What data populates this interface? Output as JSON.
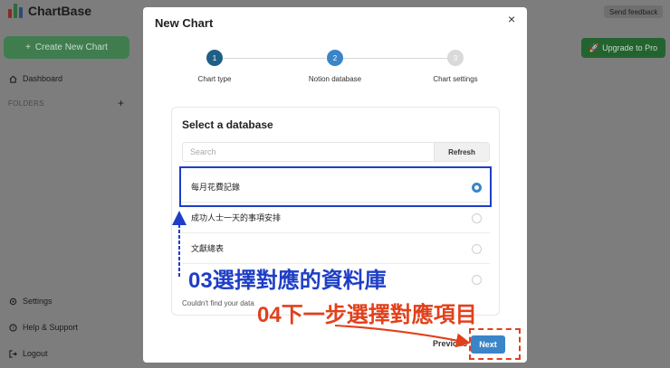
{
  "app": {
    "logo_text": "ChartBase",
    "create_button": "Create New Chart",
    "sidebar": {
      "dashboard": "Dashboard",
      "folders": "FOLDERS",
      "settings": "Settings",
      "help": "Help & Support",
      "logout": "Logout"
    },
    "send_feedback": "Send feedback",
    "upgrade_button": "Upgrade to Pro"
  },
  "modal": {
    "title": "New Chart",
    "close": "×",
    "steps": [
      {
        "number": "1",
        "label": "Chart type",
        "state": "complete"
      },
      {
        "number": "2",
        "label": "Notion database",
        "state": "active"
      },
      {
        "number": "3",
        "label": "Chart settings",
        "state": "pending"
      }
    ],
    "card": {
      "title": "Select a database",
      "search_placeholder": "Search",
      "refresh_button": "Refresh",
      "databases": [
        {
          "name": "每月花費記錄",
          "selected": true
        },
        {
          "name": "成功人士一天的事項安排",
          "selected": false
        },
        {
          "name": "文獻總表",
          "selected": false
        },
        {
          "name": "",
          "selected": false
        }
      ],
      "helper_text": "Couldn't find your data"
    },
    "previous_button": "Previous",
    "next_button": "Next"
  },
  "annotations": {
    "step3": "03選擇對應的資料庫",
    "step4": "04下一步選擇對應項目"
  },
  "colors": {
    "accent_blue": "#3a85c8",
    "annotation_blue": "#1e3ec7",
    "annotation_red": "#e2401b"
  }
}
